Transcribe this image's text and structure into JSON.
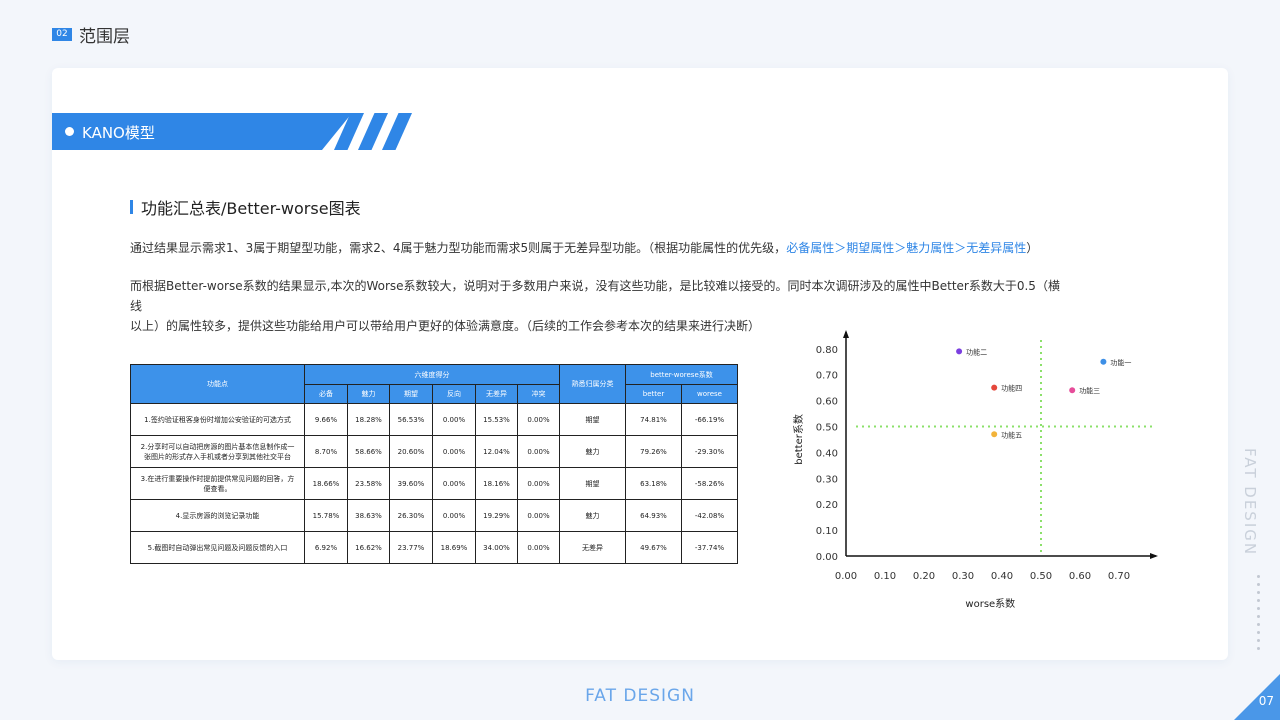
{
  "header": {
    "section_no": "02",
    "section_title": "范围层"
  },
  "banner": {
    "title": "KANO模型"
  },
  "subtitle": "功能汇总表/Better-worse图表",
  "para1": {
    "text": "通过结果显示需求1、3属于期望型功能，需求2、4属于魅力型功能而需求5则属于无差异型功能。（根据功能属性的优先级，",
    "highlight": "必备属性＞期望属性＞魅力属性＞无差异属性",
    "close": "）"
  },
  "para2": {
    "line1": "而根据Better-worse系数的结果显示,本次的Worse系数较大，说明对于多数用户来说，没有这些功能，是比较难以接受的。同时本次调研涉及的属性中Better系数大于0.5（横线",
    "line2": "以上）的属性较多，提供这些功能给用户可以带给用户更好的体验满意度。（后续的工作会参考本次的结果来进行决断）"
  },
  "table": {
    "h_feature": "功能点",
    "h_six": "六维度得分",
    "h_class": "熟悉归属分类",
    "h_bw": "better-worese系数",
    "dims": [
      "必备",
      "魅力",
      "期望",
      "反向",
      "无差异",
      "冲突"
    ],
    "bw": [
      "better",
      "worese"
    ],
    "rows": [
      {
        "feature": "1.签约验证租客身份时增加公安验证的可选方式",
        "vals": [
          "9.66%",
          "18.28%",
          "56.53%",
          "0.00%",
          "15.53%",
          "0.00%"
        ],
        "cls": "期望",
        "better": "74.81%",
        "worse": "-66.19%"
      },
      {
        "feature": "2.分享时可以自动把房源的图片基本信息制作成一张图片的形式存入手机或者分享到其他社交平台",
        "vals": [
          "8.70%",
          "58.66%",
          "20.60%",
          "0.00%",
          "12.04%",
          "0.00%"
        ],
        "cls": "魅力",
        "better": "79.26%",
        "worse": "-29.30%"
      },
      {
        "feature": "3.在进行重要操作时提前提供常见问题的回答，方便查看。",
        "vals": [
          "18.66%",
          "23.58%",
          "39.60%",
          "0.00%",
          "18.16%",
          "0.00%"
        ],
        "cls": "期望",
        "better": "63.18%",
        "worse": "-58.26%"
      },
      {
        "feature": "4.显示房源的浏览记录功能",
        "vals": [
          "15.78%",
          "38.63%",
          "26.30%",
          "0.00%",
          "19.29%",
          "0.00%"
        ],
        "cls": "魅力",
        "better": "64.93%",
        "worse": "-42.08%"
      },
      {
        "feature": "5.截图时自动弹出常见问题及问题反馈的入口",
        "vals": [
          "6.92%",
          "16.62%",
          "23.77%",
          "18.69%",
          "34.00%",
          "0.00%"
        ],
        "cls": "无差异",
        "better": "49.67%",
        "worse": "-37.74%"
      }
    ]
  },
  "chart_data": {
    "type": "scatter",
    "xlabel": "worse系数",
    "ylabel": "better系数",
    "xlim": [
      0,
      0.75
    ],
    "ylim": [
      0,
      0.85
    ],
    "xticks": [
      "0.00",
      "0.10",
      "0.20",
      "0.30",
      "0.40",
      "0.50",
      "0.60",
      "0.70"
    ],
    "yticks": [
      "0.00",
      "0.10",
      "0.20",
      "0.30",
      "0.40",
      "0.50",
      "0.60",
      "0.70",
      "0.80"
    ],
    "ref_x": 0.5,
    "ref_y": 0.5,
    "ref_color": "#8be06a",
    "points": [
      {
        "label": "功能一",
        "x": 0.66,
        "y": 0.75,
        "color": "#3d8fe6"
      },
      {
        "label": "功能二",
        "x": 0.29,
        "y": 0.79,
        "color": "#7b3fe0"
      },
      {
        "label": "功能三",
        "x": 0.58,
        "y": 0.64,
        "color": "#e64d9a"
      },
      {
        "label": "功能四",
        "x": 0.38,
        "y": 0.65,
        "color": "#e5483c"
      },
      {
        "label": "功能五",
        "x": 0.38,
        "y": 0.47,
        "color": "#f2b33a"
      }
    ]
  },
  "side_brand": "FAT DESIGN",
  "footer": "FAT DESIGN",
  "page_no": "07"
}
